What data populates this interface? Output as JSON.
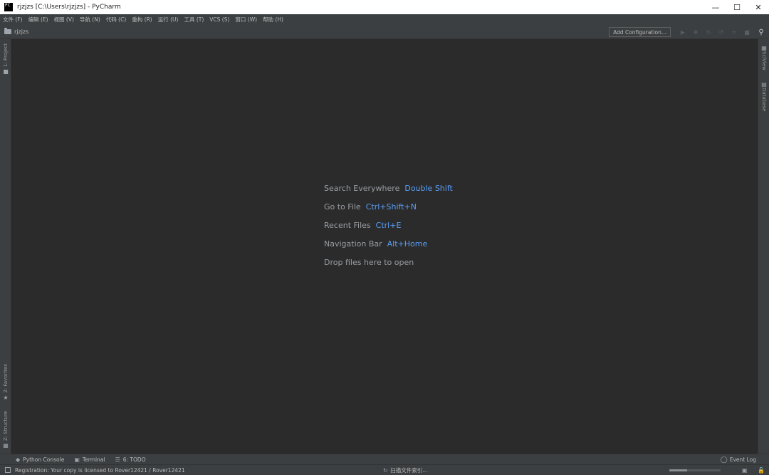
{
  "window": {
    "icon_text": "PC",
    "title": "rjzjzs [C:\\Users\\rjzjzs] - PyCharm",
    "minimize": "—",
    "maximize": "☐",
    "close": "✕"
  },
  "menu": [
    "文件 (F)",
    "编辑 (E)",
    "视图 (V)",
    "导航 (N)",
    "代码 (C)",
    "重构 (R)",
    "运行 (U)",
    "工具 (T)",
    "VCS (S)",
    "窗口 (W)",
    "帮助 (H)"
  ],
  "navbar": {
    "project": "rjzjzs",
    "add_configuration": "Add Configuration..."
  },
  "left_strip": {
    "project": "1: Project",
    "favorites": "2: Favorites",
    "structure": "Z: Structure"
  },
  "right_strip": {
    "sciview": "SciView",
    "database": "Database"
  },
  "editor_hints": [
    {
      "label": "Search Everywhere",
      "key": "Double Shift"
    },
    {
      "label": "Go to File",
      "key": "Ctrl+Shift+N"
    },
    {
      "label": "Recent Files",
      "key": "Ctrl+E"
    },
    {
      "label": "Navigation Bar",
      "key": "Alt+Home"
    },
    {
      "label": "Drop files here to open",
      "key": ""
    }
  ],
  "bottom_tools": {
    "python_console": "Python Console",
    "terminal": "Terminal",
    "todo": "6: TODO",
    "event_log": "Event Log"
  },
  "status": {
    "registration": "Registration: Your copy is licensed to Rover12421 / Rover12421",
    "indexing": "扫描文件索引...",
    "progress": 0.35
  },
  "colors": {
    "editor_bg": "#2b2b2b",
    "panel_bg": "#3c3f41",
    "hint_key": "#589df6",
    "hint_label": "#9a9ea2"
  }
}
